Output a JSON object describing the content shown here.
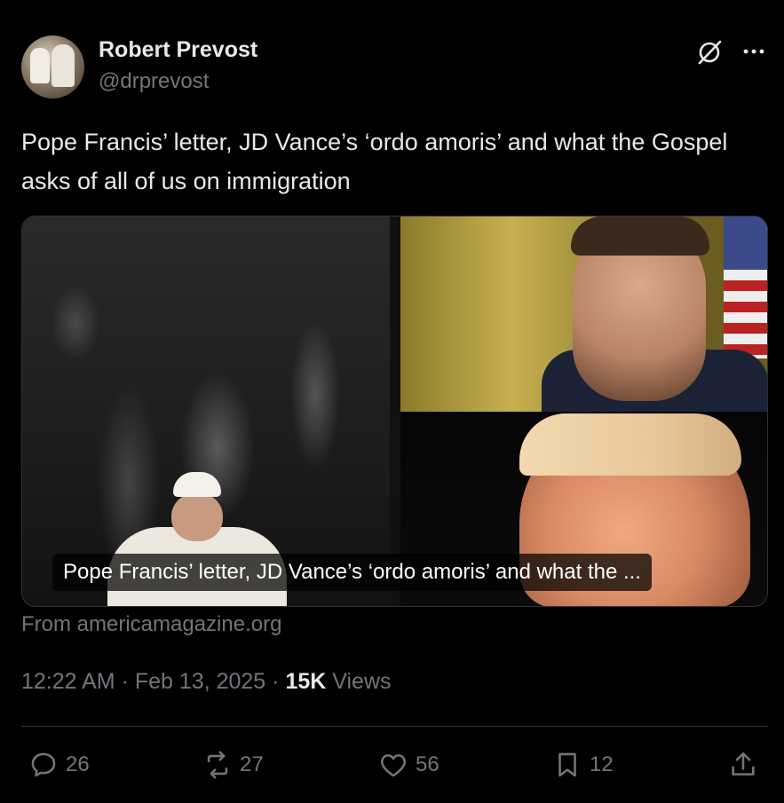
{
  "author": {
    "display_name": "Robert Prevost",
    "handle": "@drprevost"
  },
  "header_icons": [
    "grok-icon",
    "more-icon"
  ],
  "tweet": {
    "text": "Pope Francis’ letter, JD Vance’s ‘ordo amoris’ and what the Gospel asks of all of us on immigration"
  },
  "card": {
    "title": "Pope Francis’ letter, JD Vance’s ‘ordo amoris’ and what the ...",
    "source": "From americamagazine.org"
  },
  "meta": {
    "time": "12:22 AM",
    "separator": "·",
    "date": "Feb 13, 2025",
    "views_count": "15K",
    "views_label": "Views"
  },
  "actions": {
    "replies": "26",
    "reposts": "27",
    "likes": "56",
    "bookmarks": "12"
  },
  "colors": {
    "background": "#000000",
    "primary_text": "#e7e9ea",
    "secondary_text": "#71767b",
    "divider": "#2f3336"
  }
}
